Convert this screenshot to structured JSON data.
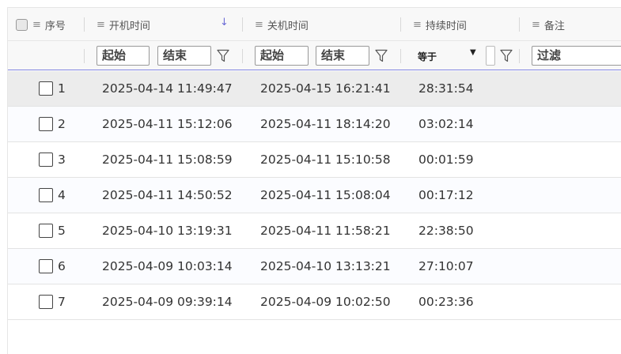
{
  "columns": {
    "index": "序号",
    "start_time": "开机时间",
    "end_time": "关机时间",
    "duration": "持续时间",
    "note": "备注"
  },
  "filters": {
    "start_from": "起始",
    "start_to": "结束",
    "end_from": "起始",
    "end_to": "结束",
    "duration_op": "等于",
    "note_placeholder": "过滤"
  },
  "icons": {
    "column_menu": "≡",
    "sort_desc": "↓",
    "dropdown": "▼"
  },
  "rows": [
    {
      "index": "1",
      "start": "2025-04-14 11:49:47",
      "end": "2025-04-15 16:21:41",
      "duration": "28:31:54",
      "note": ""
    },
    {
      "index": "2",
      "start": "2025-04-11 15:12:06",
      "end": "2025-04-11 18:14:20",
      "duration": "03:02:14",
      "note": ""
    },
    {
      "index": "3",
      "start": "2025-04-11 15:08:59",
      "end": "2025-04-11 15:10:58",
      "duration": "00:01:59",
      "note": ""
    },
    {
      "index": "4",
      "start": "2025-04-11 14:50:52",
      "end": "2025-04-11 15:08:04",
      "duration": "00:17:12",
      "note": ""
    },
    {
      "index": "5",
      "start": "2025-04-10 13:19:31",
      "end": "2025-04-11 11:58:21",
      "duration": "22:38:50",
      "note": ""
    },
    {
      "index": "6",
      "start": "2025-04-09 10:03:14",
      "end": "2025-04-10 13:13:21",
      "duration": "27:10:07",
      "note": ""
    },
    {
      "index": "7",
      "start": "2025-04-09 09:39:14",
      "end": "2025-04-09 10:02:50",
      "duration": "00:23:36",
      "note": ""
    }
  ],
  "selected_row": 1,
  "colors": {
    "accent": "#6b6bd6",
    "header_bg": "#f8f8f8",
    "selected_row_bg": "#ececec"
  }
}
